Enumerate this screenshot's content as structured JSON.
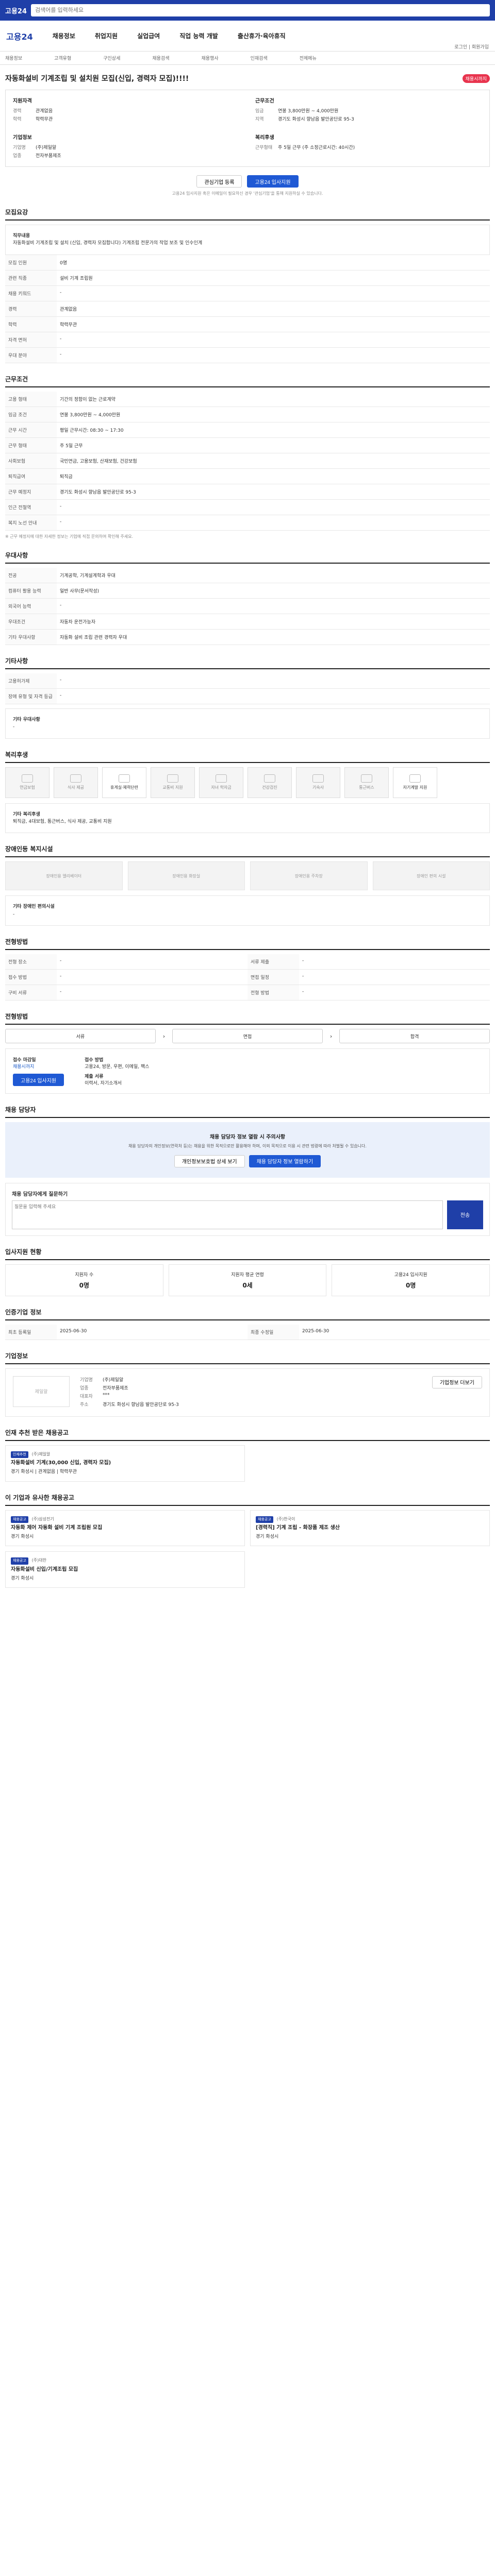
{
  "topbar": {
    "logo": "고용24",
    "search_placeholder": "검색어를 입력하세요"
  },
  "nav": {
    "brand": "고용24",
    "items": [
      "채용정보",
      "취업지원",
      "실업급여",
      "직업 능력 개발",
      "출산휴가·육아휴직"
    ]
  },
  "utils": "로그인 | 회원가입",
  "subnav": [
    "채용정보",
    "고객유형",
    "구인상세",
    "채용검색",
    "채용행사",
    "인재검색",
    "전체메뉴"
  ],
  "job": {
    "title": "자동화설비 기계조립 및 설치원 모집(신입, 경력자 모집)!!!!",
    "badge": "채용시까지",
    "company_head": "기업정보",
    "company_rows": [
      [
        "기업명",
        "(주)제일알"
      ],
      [
        "대표",
        "***"
      ],
      [
        "업종",
        "전자부품제조"
      ]
    ],
    "cond_head": "근무조건",
    "cond_rows": [
      [
        "임금",
        "연봉 3,800만원 ~ 4,000만원"
      ],
      [
        "지역",
        "경기도 화성시 향남읍 발안공단로 95-3"
      ],
      [
        "고용형태",
        "기간의 정함이 없는 근로계약"
      ]
    ],
    "req_head": "지원자격",
    "req_rows": [
      [
        "경력",
        "관계없음"
      ],
      [
        "학력",
        "학력무관"
      ]
    ],
    "work_head": "복리후생",
    "work_rows": [
      [
        "근무형태",
        "주 5일 근무 (주 소정근로시간: 40시간)"
      ]
    ]
  },
  "actions": {
    "bookmark": "관심기업 등록",
    "apply": "고용24 입사지원"
  },
  "apply_note": "고용24 입사지원 혹은 이메일이 필요하신 경우 '관심기업'을 통해 지원하실 수 있습니다.",
  "sections": {
    "recruit": "모집요강",
    "conditions": "근무조건",
    "prefer": "우대사항",
    "other": "기타사항",
    "welfare": "복리후생",
    "disabled": "장애인등 복지시설",
    "screening": "전형방법",
    "apply": "전형방법",
    "contact": "채용 담당자",
    "stats": "입사지원 현황",
    "announce": "인증기업 정보",
    "company": "기업정보",
    "recommend": "인재 추천 받은 채용공고",
    "similar": "이 기업과 유사한 채용공고"
  },
  "recruit": {
    "duty_title": "직무내용",
    "duty_body": "자동화설비 기계조립 및 설치 (신입, 경력자 모집합니다) 기계조립 전문가의 작업 보조 및 인수인계",
    "rows": [
      [
        "모집 인원",
        "0명"
      ],
      [
        "관련 직종",
        "설비 기계 조립원"
      ],
      [
        "채용 키워드",
        "-"
      ],
      [
        "경력",
        "관계없음"
      ],
      [
        "학력",
        "학력무관"
      ],
      [
        "자격 면허",
        "-"
      ],
      [
        "우대 분야",
        "-"
      ]
    ]
  },
  "conditions": {
    "rows": [
      [
        "고용 형태",
        "기간의 정함이 없는 근로계약"
      ],
      [
        "임금 조건",
        "연봉 3,800만원 ~ 4,000만원"
      ],
      [
        "근무 시간",
        "평일 근무시간: 08:30 ~ 17:30"
      ],
      [
        "근무 형태",
        "주 5일 근무"
      ],
      [
        "사회보험",
        "국민연금, 고용보험, 산재보험, 건강보험"
      ],
      [
        "퇴직급여",
        "퇴직금"
      ],
      [
        "근무 예정지",
        "경기도 화성시 향남읍 발안공단로 95-3"
      ],
      [
        "인근 전철역",
        "-"
      ],
      [
        "복지 노선 안내",
        "-"
      ]
    ],
    "note": "※ 근무 예정지에 대한 자세한 정보는 기업에 직접 문의하여 확인해 주세요."
  },
  "prefer": {
    "rows": [
      [
        "전공",
        "기계공학, 기계설계학과 우대"
      ],
      [
        "컴퓨터 활용 능력",
        "일반 사무(문서작성)"
      ],
      [
        "외국어 능력",
        "-"
      ],
      [
        "우대조건",
        "자동차 운전가능자"
      ],
      [
        "기타 우대사항",
        "자동화 설비 조립 관련 경력자 우대"
      ]
    ]
  },
  "other": {
    "rows": [
      [
        "고용허가제",
        "-"
      ],
      [
        "장애 유형 및 자격 등급",
        "-"
      ]
    ],
    "extra_title": "기타 우대사항",
    "extra_body": "-"
  },
  "welfare": {
    "items": [
      "연금보험",
      "식사 제공",
      "휴게실·체력단련",
      "교통비 지원",
      "자녀 학자금",
      "건강검진",
      "기숙사",
      "통근버스",
      "자기계발 지원"
    ],
    "detail_title": "기타 복리후생",
    "detail_body": "퇴직금, 4대보험, 통근버스, 식사 제공, 교통비 지원"
  },
  "disabled": {
    "items": [
      "장애인용 엘리베이터",
      "장애인용 화장실",
      "장애인용 주차장",
      "장애인 편의 시설"
    ],
    "detail_title": "기타 장애인 편의시설",
    "detail_body": "-"
  },
  "screening_rows": [
    [
      "전형 장소",
      "-"
    ],
    [
      "서류 제출",
      "-"
    ],
    [
      "접수 방법",
      "-"
    ],
    [
      "면접 일정",
      "-"
    ],
    [
      "구비 서류",
      "-"
    ],
    [
      "전형 방법",
      "-"
    ]
  ],
  "process": {
    "steps": [
      "서류",
      "면접",
      "합격"
    ]
  },
  "apply_box": {
    "period_label": "접수 마감일",
    "period_value": "채용시까지",
    "apply_button": "고용24 입사지원",
    "method_label": "접수 방법",
    "method_value": "고용24, 방문, 우편, 이메일, 팩스",
    "doc_label": "제출 서류",
    "doc_value": "이력서, 자기소개서"
  },
  "contact": {
    "warning": "채용 담당자 정보 열람 시 주의사항",
    "body": "채용 담당자의 개인정보(연락처 등)는 채용을 위한 목적으로만 활용해야 하며, 이외 목적으로 이용 시 관련 법령에 따라 처벌될 수 있습니다.",
    "confirm_label": "개인정보보호법 상세 보기",
    "view_label": "채용 담당자 정보 열람하기",
    "qa_title": "채용 담당자에게 질문하기",
    "qa_placeholder": "질문을 입력해 주세요",
    "send_label": "전송"
  },
  "stats": {
    "cols": [
      [
        "지원자 수",
        "0명"
      ],
      [
        "지원자 평균 연령",
        "0세"
      ],
      [
        "고용24 입사지원",
        "0명"
      ]
    ]
  },
  "announce": {
    "rows": [
      [
        "최초 등록일",
        "2025-06-30"
      ],
      [
        "최종 수정일",
        "2025-06-30"
      ]
    ]
  },
  "company": {
    "logo": "제일알",
    "rows": [
      [
        "기업명",
        "(주)제일알"
      ],
      [
        "업종",
        "전자부품제조"
      ],
      [
        "대표자",
        "***"
      ],
      [
        "주소",
        "경기도 화성시 향남읍 발안공단로 95-3"
      ]
    ],
    "link": "기업정보 더보기"
  },
  "recommend": {
    "items": [
      {
        "tag": "인재추천",
        "company": "(주)제일알",
        "title": "자동화설비 기계(30,000 신입, 경력자 모집)",
        "desc": "경기 화성시 | 관계없음 | 학력무관"
      }
    ]
  },
  "similar": {
    "items": [
      {
        "tag": "채용공고",
        "company": "(주)삼성전기",
        "title": "자동화 제어 자동화 설비 기계 조립원 모집",
        "desc": "경기 화성시"
      },
      {
        "tag": "채용공고",
        "company": "(주)한국이",
        "title": "[경력직] 기계 조립 - 화장품 제조 생산",
        "desc": "경기 화성시"
      },
      {
        "tag": "채용공고",
        "company": "(주)대한",
        "title": "자동화설비 신입/기계조립 모집",
        "desc": "경기 화성시"
      }
    ]
  },
  "colors": {
    "brand": "#1f3fa8",
    "accent": "#1f59d4",
    "badge": "#e8344e"
  }
}
